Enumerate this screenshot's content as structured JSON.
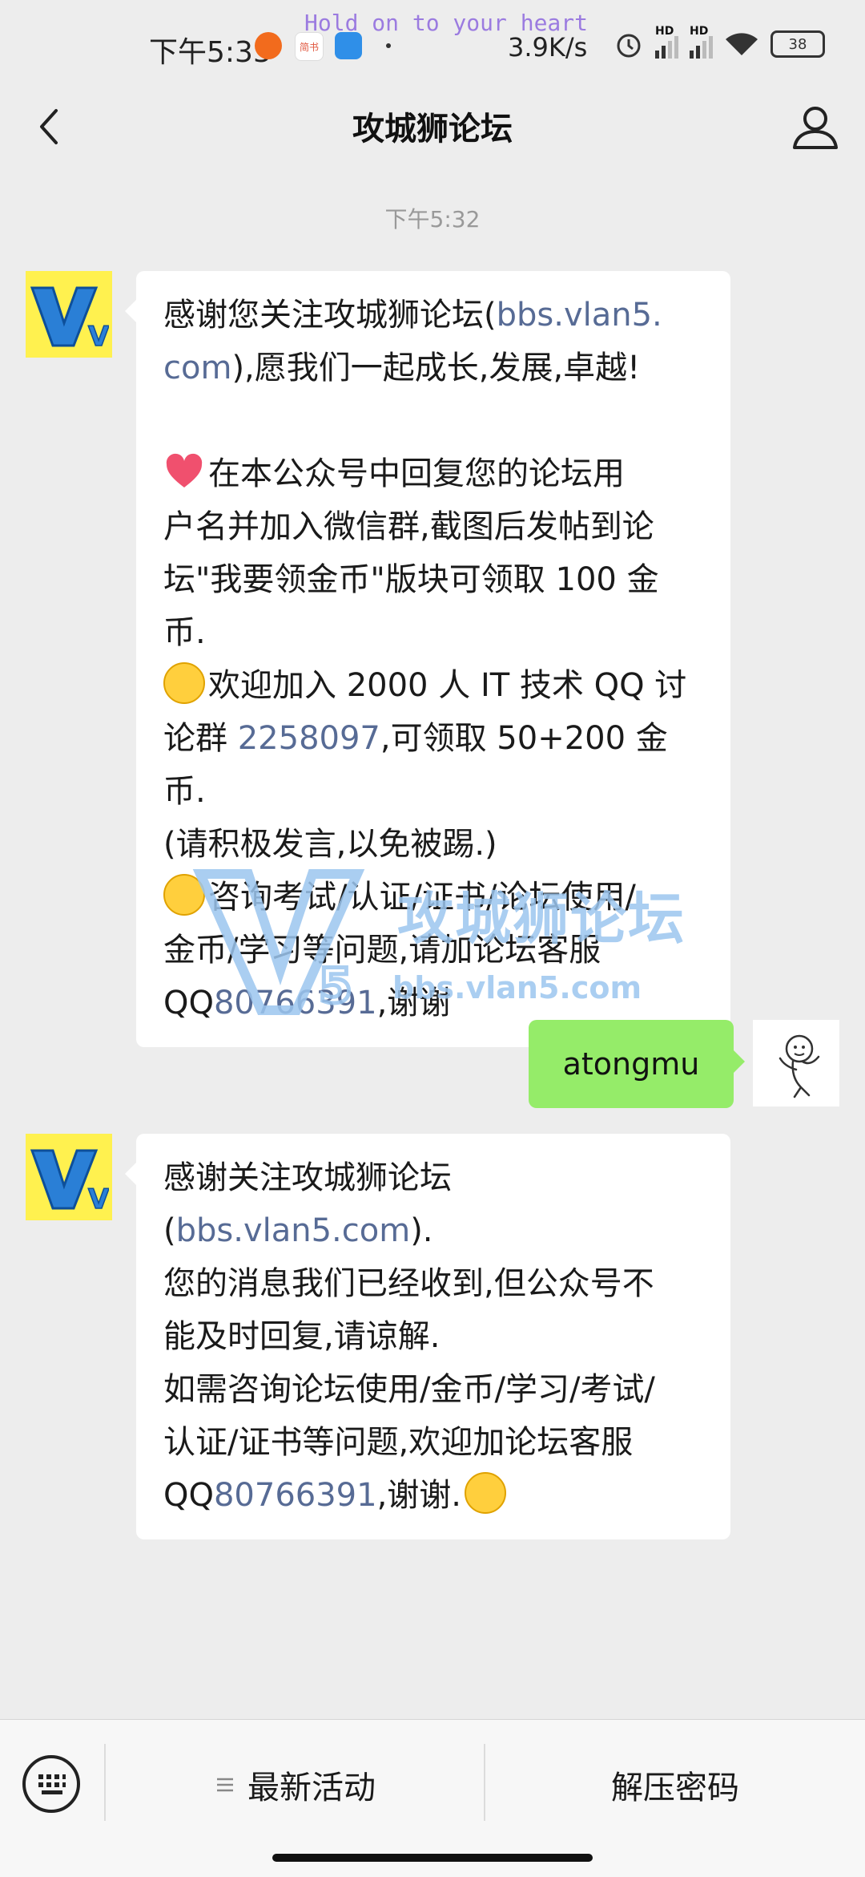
{
  "status_bar": {
    "time": "下午5:33",
    "banner": "Hold on to your heart",
    "notif_label": "简书",
    "network_speed": "3.9K/s",
    "signal_1": "HD",
    "signal_2": "HD",
    "battery": "38",
    "icons": [
      "red-app-icon",
      "jianshu-icon",
      "remote-app-icon",
      "dot-icon",
      "alarm-icon",
      "signal-icon",
      "wifi-icon",
      "battery-icon"
    ]
  },
  "nav": {
    "title": "攻城狮论坛",
    "back_icon": "chevron-left-icon",
    "profile_icon": "person-icon"
  },
  "chat": {
    "timestamp": "下午5:32",
    "msg1": {
      "l1a": "感谢您关注攻城狮论坛(",
      "l1b": "bbs.vlan5.",
      "l2a": "com",
      "l2b": "),愿我们一起成长,发展,卓越!",
      "l3": "在本公众号中回复您的论坛用",
      "l4": "户名并加入微信群,截图后发帖到论",
      "l5": "坛\"我要领金币\"版块可领取 100 金",
      "l6": "币.",
      "l7": "欢迎加入 2000 人 IT 技术 QQ 讨",
      "l8a": "论群 ",
      "l8b": "2258097",
      "l8c": ",可领取 50+200 金币.",
      "l9": "(请积极发言,以免被踢.)",
      "l10": "咨询考试/认证/证书/论坛使用/",
      "l11": "金币/学习等问题,请加论坛客服",
      "l12a": "QQ",
      "l12b": "80766391",
      "l12c": ",谢谢"
    },
    "my_msg": "atongmu",
    "msg2": {
      "l1a": "感谢关注攻城狮论坛(",
      "l1b": "bbs.vlan5.com",
      "l1c": ").",
      "l2": "您的消息我们已经收到,但公众号不",
      "l3": "能及时回复,请谅解.",
      "l4": "如需咨询论坛使用/金币/学习/考试/",
      "l5": "认证/证书等问题,欢迎加论坛客服",
      "l6a": "QQ",
      "l6b": "80766391",
      "l6c": ",谢谢."
    },
    "avatar_text": "V5",
    "watermark": {
      "cn": "攻城狮论坛",
      "url": "bbs.vlan5.com",
      "logo": "V5"
    },
    "emoji_icons": [
      "heart-emoji",
      "smile-emoji",
      "wink-emoji"
    ]
  },
  "bottom": {
    "keyboard_icon": "keyboard-icon",
    "menu1": "最新活动",
    "menu2": "解压密码"
  },
  "colors": {
    "accent_green": "#95ec69",
    "link_blue": "#576b95",
    "avatar_yellow": "#fff14f",
    "background": "#ededed"
  }
}
